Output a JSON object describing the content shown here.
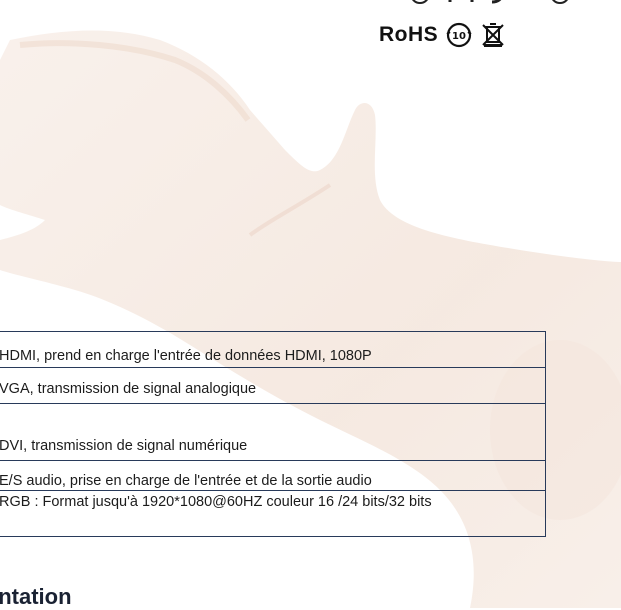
{
  "certifications": {
    "rohs_label": "RoHS",
    "icons": [
      "certification-marks-icon",
      "rohs-10-icon",
      "weee-crossed-bin-icon"
    ]
  },
  "specs": {
    "rows": [
      "HDMI, prend en charge l'entrée de données HDMI, 1080P",
      "VGA, transmission de signal analogique",
      "DVI, transmission de signal numérique",
      "E/S audio, prise en charge de l'entrée et de la sortie audio",
      "RGB : Format jusqu'à 1920*1080@60HZ couleur 16 /24 bits/32 bits"
    ]
  },
  "section": {
    "heading": "entation"
  },
  "colors": {
    "table_border": "#283a5a",
    "hand_tint": "#f3e4d9"
  }
}
